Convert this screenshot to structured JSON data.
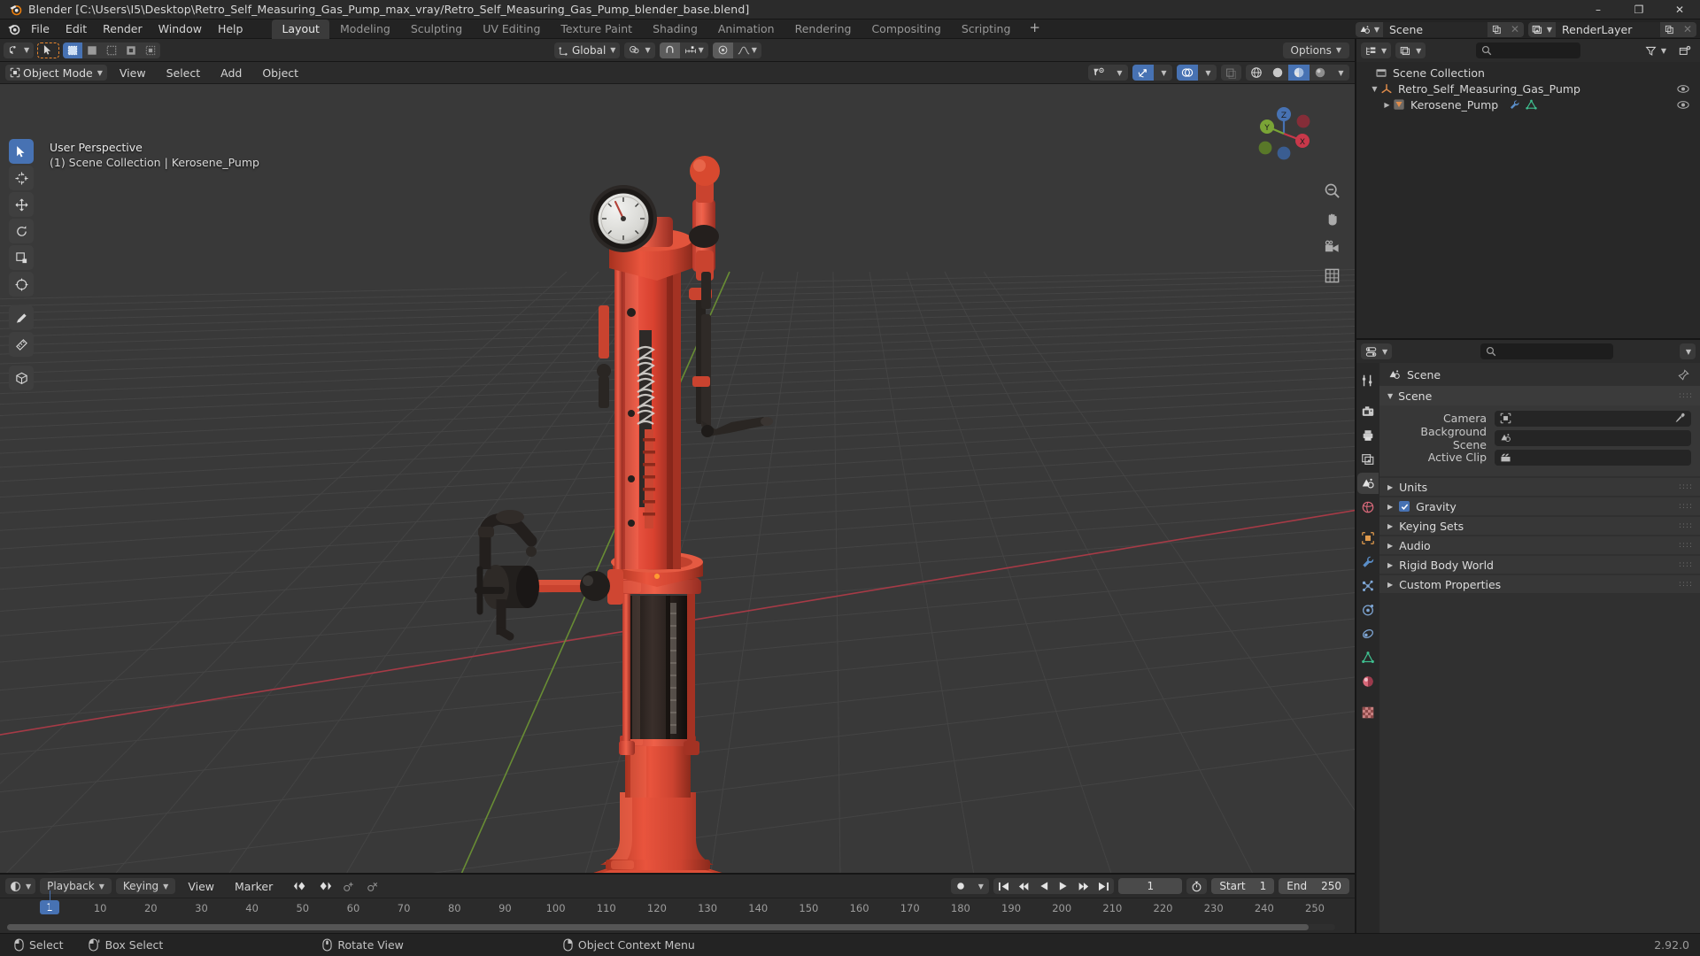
{
  "window": {
    "title": "Blender [C:\\Users\\I5\\Desktop\\Retro_Self_Measuring_Gas_Pump_max_vray/Retro_Self_Measuring_Gas_Pump_blender_base.blend]",
    "minimize": "–",
    "maximize": "❐",
    "close": "✕"
  },
  "menu": {
    "items": [
      "File",
      "Edit",
      "Render",
      "Window",
      "Help"
    ],
    "workspaces": [
      {
        "label": "Layout",
        "active": true
      },
      {
        "label": "Modeling",
        "active": false
      },
      {
        "label": "Sculpting",
        "active": false
      },
      {
        "label": "UV Editing",
        "active": false
      },
      {
        "label": "Texture Paint",
        "active": false
      },
      {
        "label": "Shading",
        "active": false
      },
      {
        "label": "Animation",
        "active": false
      },
      {
        "label": "Rendering",
        "active": false
      },
      {
        "label": "Compositing",
        "active": false
      },
      {
        "label": "Scripting",
        "active": false
      },
      {
        "label": "+",
        "active": false
      }
    ],
    "scene_id": "Scene",
    "viewlayer_id": "RenderLayer"
  },
  "viewport": {
    "mode": "Object Mode",
    "menus": [
      "View",
      "Select",
      "Add",
      "Object"
    ],
    "transform_orientation": "Global",
    "options_label": "Options",
    "overlay_line1": "User Perspective",
    "overlay_line2": "(1) Scene Collection | Kerosene_Pump",
    "gizmo_axes": {
      "x": "X",
      "y": "Y",
      "z": "Z"
    },
    "colors": {
      "background": "#393939",
      "grid": "#4a4a4a",
      "axis_x": "#c9384a",
      "axis_y": "#7aa436",
      "model_red": "#e04a3c",
      "model_dark": "#2a2422",
      "accent_blue": "#4772b3",
      "origin_orange": "#ff8c2b"
    }
  },
  "timeline": {
    "menus": [
      "Playback",
      "Keying",
      "View",
      "Marker"
    ],
    "current_frame": "1",
    "start_label": "Start",
    "start_value": "1",
    "end_label": "End",
    "end_value": "250",
    "ticks": [
      "1",
      "10",
      "20",
      "30",
      "40",
      "50",
      "60",
      "70",
      "80",
      "90",
      "100",
      "110",
      "120",
      "130",
      "140",
      "150",
      "160",
      "170",
      "180",
      "190",
      "200",
      "210",
      "220",
      "230",
      "240",
      "250"
    ]
  },
  "outliner": {
    "search_placeholder": "",
    "rows": [
      {
        "label": "Scene Collection",
        "depth": 0,
        "icon": "collection-icon",
        "disclosure": "",
        "eye": false
      },
      {
        "label": "Retro_Self_Measuring_Gas_Pump",
        "depth": 1,
        "icon": "empty-axis-icon",
        "disclosure": "▼",
        "eye": true
      },
      {
        "label": "Kerosene_Pump",
        "depth": 2,
        "icon": "mesh-object-icon",
        "disclosure": "▶",
        "eye": true
      }
    ]
  },
  "properties": {
    "search_placeholder": "",
    "breadcrumb": "Scene",
    "panels": [
      {
        "title": "Scene",
        "expanded": true,
        "fields": [
          {
            "label": "Camera",
            "value": "",
            "icon": "camera-data-icon",
            "eyedropper": true
          },
          {
            "label": "Background Scene",
            "value": "",
            "icon": "scene-icon",
            "eyedropper": false
          },
          {
            "label": "Active Clip",
            "value": "",
            "icon": "clip-icon",
            "eyedropper": false
          }
        ]
      },
      {
        "title": "Units",
        "expanded": false,
        "checkbox": false
      },
      {
        "title": "Gravity",
        "expanded": false,
        "checkbox": true
      },
      {
        "title": "Keying Sets",
        "expanded": false,
        "checkbox": false
      },
      {
        "title": "Audio",
        "expanded": false,
        "checkbox": false
      },
      {
        "title": "Rigid Body World",
        "expanded": false,
        "checkbox": false
      },
      {
        "title": "Custom Properties",
        "expanded": false,
        "checkbox": false
      }
    ],
    "tabs": [
      {
        "name": "tool",
        "active": false
      },
      {
        "name": "render",
        "active": false
      },
      {
        "name": "output",
        "active": false
      },
      {
        "name": "view-layer",
        "active": false
      },
      {
        "name": "scene",
        "active": true
      },
      {
        "name": "world",
        "active": false
      },
      {
        "name": "object",
        "active": false
      },
      {
        "name": "modifiers",
        "active": false
      },
      {
        "name": "particles",
        "active": false
      },
      {
        "name": "physics",
        "active": false
      },
      {
        "name": "constraints",
        "active": false
      },
      {
        "name": "object-data",
        "active": false
      },
      {
        "name": "material",
        "active": false
      },
      {
        "name": "texture",
        "active": false
      }
    ]
  },
  "statusbar": {
    "items": [
      {
        "icon": "mouse-left-icon",
        "label": "Select"
      },
      {
        "icon": "mouse-drag-icon",
        "label": "Box Select"
      },
      {
        "icon": "mouse-middle-icon",
        "label": "Rotate View"
      },
      {
        "icon": "mouse-right-icon",
        "label": "Object Context Menu"
      }
    ],
    "version": "2.92.0"
  }
}
